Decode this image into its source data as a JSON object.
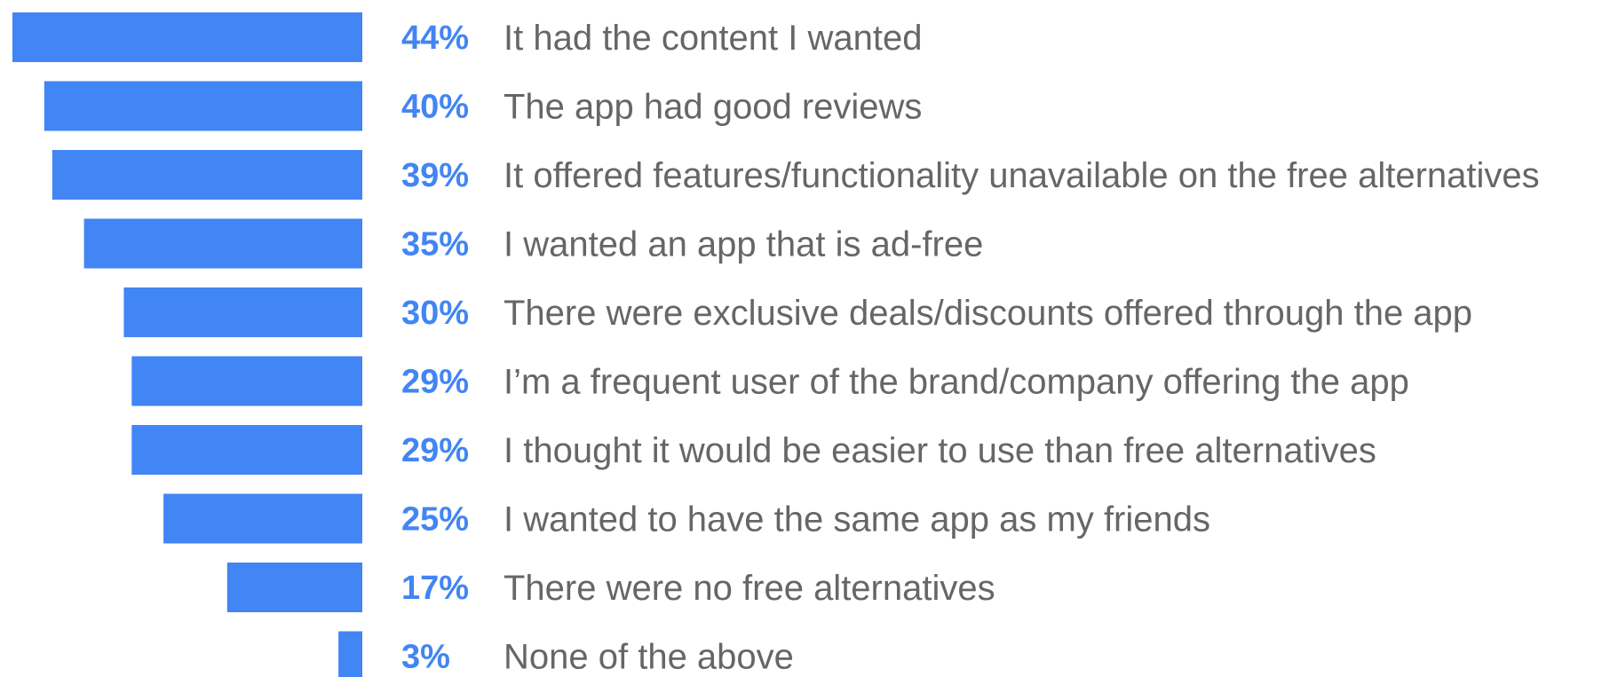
{
  "colors": {
    "bar": "#4285f4",
    "percent_text": "#4285f4",
    "category_text": "#666666"
  },
  "chart_data": {
    "type": "bar",
    "orientation": "horizontal",
    "direction": "right-to-left",
    "grid": false,
    "legend": "none",
    "xlim": [
      0,
      44
    ],
    "categories": [
      "It had the content I wanted",
      "The app had good reviews",
      "It offered features/functionality unavailable on the free alternatives",
      "I wanted an app that is ad-free",
      "There were exclusive deals/discounts offered through the app",
      "I’m a frequent user of the brand/company offering the app",
      "I thought it would be easier to use than free alternatives",
      "I wanted to have the same app as my friends",
      "There were no free alternatives",
      "None of the above"
    ],
    "values": [
      44,
      40,
      39,
      35,
      30,
      29,
      29,
      25,
      17,
      3
    ],
    "value_labels": [
      "44%",
      "40%",
      "39%",
      "35%",
      "30%",
      "29%",
      "29%",
      "25%",
      "17%",
      "3%"
    ]
  }
}
